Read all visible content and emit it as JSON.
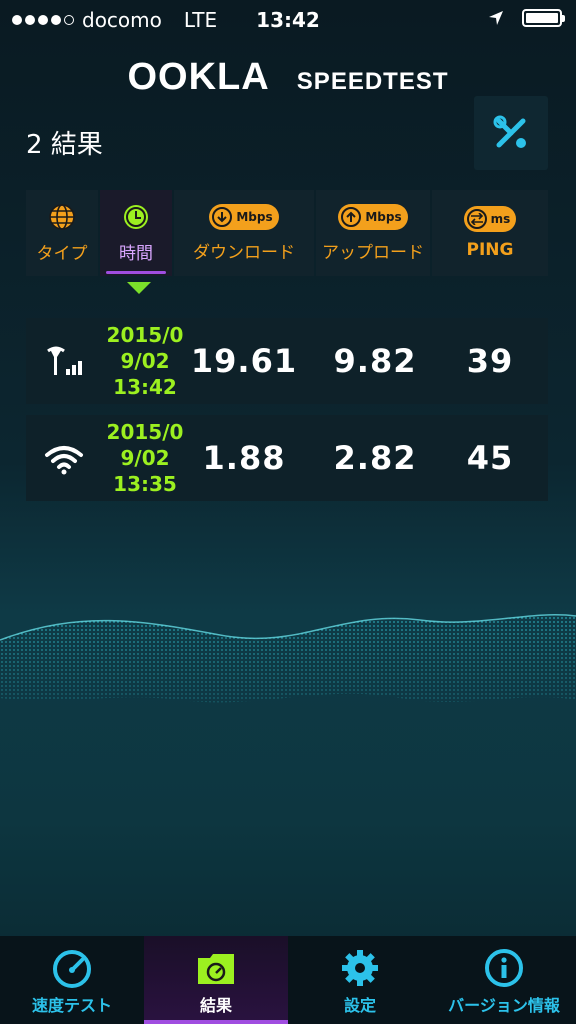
{
  "status_bar": {
    "carrier": "docomo",
    "network": "LTE",
    "time": "13:42"
  },
  "header": {
    "logo_ookla": "OOKLA",
    "logo_speedtest": "SPEEDTEST",
    "results_count": "2 結果",
    "settings_icon": "tools-icon"
  },
  "tabs": [
    {
      "label": "タイプ",
      "icon": "globe-icon"
    },
    {
      "label": "時間",
      "icon": "clock-icon",
      "active": true
    },
    {
      "label": "ダウンロード",
      "icon": "download-arrow-icon",
      "unit": "Mbps"
    },
    {
      "label": "アップロード",
      "icon": "upload-arrow-icon",
      "unit": "Mbps"
    },
    {
      "label": "PING",
      "icon": "ping-arrows-icon",
      "unit": "ms"
    }
  ],
  "results": [
    {
      "type": "cellular-signal-icon",
      "date_line1": "2015/0",
      "date_line2": "9/02",
      "date_line3": "13:42",
      "download": "19.61",
      "upload": "9.82",
      "ping": "39"
    },
    {
      "type": "wifi-icon",
      "date_line1": "2015/0",
      "date_line2": "9/02",
      "date_line3": "13:35",
      "download": "1.88",
      "upload": "2.82",
      "ping": "45"
    }
  ],
  "nav": [
    {
      "label": "速度テスト",
      "icon": "speedometer-icon"
    },
    {
      "label": "結果",
      "icon": "folder-icon",
      "active": true
    },
    {
      "label": "設定",
      "icon": "gear-icon"
    },
    {
      "label": "バージョン情報",
      "icon": "info-icon"
    }
  ],
  "colors": {
    "accent_orange": "#f3a01c",
    "accent_green": "#9cf020",
    "accent_cyan": "#2cc2ea",
    "accent_purple": "#a04de0"
  }
}
